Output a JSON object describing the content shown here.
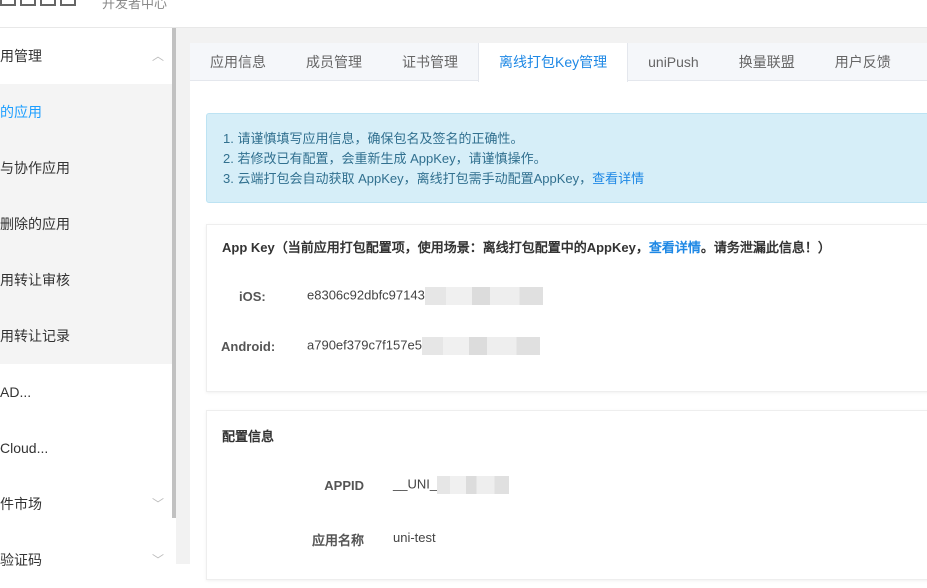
{
  "header": {
    "logo_text": "开发者中心"
  },
  "sidebar": {
    "items": [
      {
        "label": "用管理",
        "type": "group",
        "chevron": "chevron-up-icon"
      },
      {
        "label": "的应用",
        "type": "sub",
        "active": true
      },
      {
        "label": "与协作应用",
        "type": "sub"
      },
      {
        "label": "删除的应用",
        "type": "sub"
      },
      {
        "label": "用转让审核",
        "type": "sub"
      },
      {
        "label": "用转让记录",
        "type": "sub"
      },
      {
        "label": "AD...",
        "type": "item"
      },
      {
        "label": "Cloud...",
        "type": "item"
      },
      {
        "label": "件市场",
        "type": "group",
        "chevron": "chevron-down-icon"
      },
      {
        "label": "验证码",
        "type": "group",
        "chevron": "chevron-down-icon"
      }
    ]
  },
  "tabs": [
    "应用信息",
    "成员管理",
    "证书管理",
    "离线打包Key管理",
    "uniPush",
    "换量联盟",
    "用户反馈"
  ],
  "active_tab": "离线打包Key管理",
  "alert": {
    "line1": "1. 请谨慎填写应用信息，确保包名及签名的正确性。",
    "line2": "2. 若修改已有配置，会重新生成 AppKey，请谨慎操作。",
    "line3": "3. 云端打包会自动获取 AppKey，离线打包需手动配置AppKey，",
    "line3_link": "查看详情"
  },
  "appkey": {
    "title_pre": "App Key（当前应用打包配置项，使用场景：离线打包配置中的AppKey，",
    "title_link": "查看详情",
    "title_post": "。请务泄漏此信息！）",
    "ios_label": "iOS:",
    "ios_value": "e8306c92dbfc97143",
    "android_label": "Android:",
    "android_value": "a790ef379c7f157e5"
  },
  "config": {
    "title": "配置信息",
    "appid_label": "APPID",
    "appid_value": "__UNI_",
    "name_label": "应用名称",
    "name_value": "uni-test"
  },
  "colors": {
    "accent": "#1e88e5",
    "alert_bg": "#d6eef8"
  }
}
